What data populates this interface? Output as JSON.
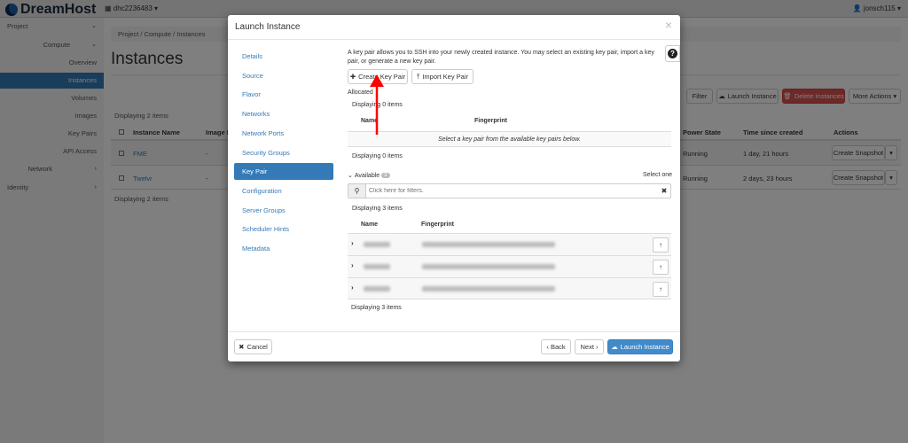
{
  "header": {
    "brand": "DreamHost",
    "project": "dhc2236483 ▾",
    "user": "jonsch115 ▾"
  },
  "sidebar": {
    "items": [
      {
        "label": "Project",
        "chev": "⌄"
      },
      {
        "label": "Compute",
        "chev": "⌄"
      },
      {
        "label": "Overview"
      },
      {
        "label": "Instances"
      },
      {
        "label": "Volumes"
      },
      {
        "label": "Images"
      },
      {
        "label": "Key Pairs"
      },
      {
        "label": "API Access"
      },
      {
        "label": "Network",
        "chev": "›"
      },
      {
        "label": "Identity",
        "chev": "›"
      }
    ]
  },
  "page": {
    "breadcrumb": "Project /  Compute /  Instances",
    "title": "Instances",
    "toolbar": {
      "filter": "Filter",
      "launch": "Launch Instance",
      "delete": "Delete Instances",
      "more": "More Actions ▾"
    },
    "count_top": "Displaying 2 items",
    "count_bottom": "Displaying 2 items",
    "columns": [
      "Instance Name",
      "Image N",
      "Power State",
      "Time since created",
      "Actions"
    ],
    "rows": [
      {
        "name": "FME",
        "image": "-",
        "power": "Running",
        "time": "1 day, 21 hours",
        "action": "Create Snapshot"
      },
      {
        "name": "Twelvr",
        "image": "-",
        "power": "Running",
        "time": "2 days, 23 hours",
        "action": "Create Snapshot"
      }
    ]
  },
  "modal": {
    "title": "Launch Instance",
    "close": "×",
    "nav": [
      "Details",
      "Source",
      "Flavor",
      "Networks",
      "Network Ports",
      "Security Groups",
      "Key Pair",
      "Configuration",
      "Server Groups",
      "Scheduler Hints",
      "Metadata"
    ],
    "active_nav": "Key Pair",
    "help": "?",
    "description": "A key pair allows you to SSH into your newly created instance. You may select an existing key pair, import a key pair, or generate a new key pair.",
    "create_btn": "Create Key Pair",
    "import_btn": "Import Key Pair",
    "allocated": {
      "label": "Allocated",
      "count": "Displaying 0 items",
      "col_name": "Name",
      "col_fp": "Fingerprint",
      "empty": "Select a key pair from the available key pairs below.",
      "count2": "Displaying 0 items"
    },
    "available": {
      "label": "Available",
      "badge": "3",
      "select": "Select one",
      "filter_placeholder": "Click here for filters.",
      "count": "Displaying 3 items",
      "col_name": "Name",
      "col_fp": "Fingerprint",
      "count2": "Displaying 3 items"
    },
    "footer": {
      "cancel": "Cancel",
      "back": "‹ Back",
      "next": "Next ›",
      "launch": "Launch Instance"
    }
  },
  "colors": {
    "primary": "#337ab7",
    "danger": "#d9534f",
    "annotation_arrow": "#ff0000"
  }
}
